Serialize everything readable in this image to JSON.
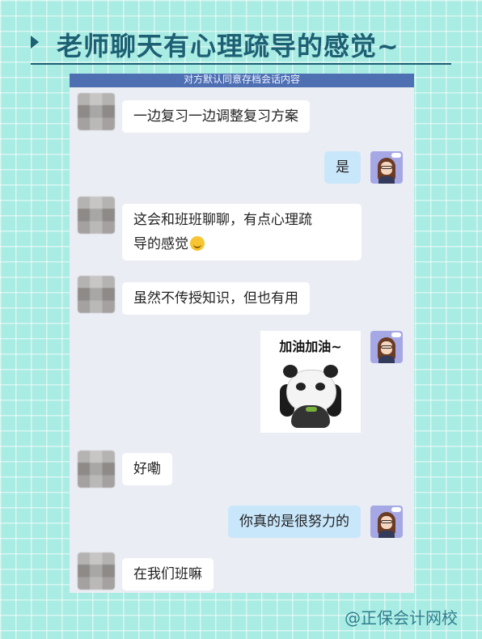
{
  "header": {
    "title": "老师聊天有心理疏导的感觉~"
  },
  "chat": {
    "topbar": "对方默认同意存档会话内容",
    "messages": [
      {
        "side": "in",
        "text": "一边复习一边调整复习方案"
      },
      {
        "side": "out",
        "text": "是"
      },
      {
        "side": "in",
        "text_line1": "这会和班班聊聊，有点心理疏",
        "text_line2": "导的感觉",
        "emoji": "thinking-emoji"
      },
      {
        "side": "in",
        "text": "虽然不传授知识，但也有用"
      },
      {
        "side": "out",
        "sticker_caption": "加油加油~",
        "sticker": "panda-sticker"
      },
      {
        "side": "in",
        "text": "好嘞"
      },
      {
        "side": "out",
        "text": "你真的是很努力的"
      },
      {
        "side": "in",
        "text": "在我们班嘛"
      }
    ]
  },
  "watermark": "@正保会计网校"
}
